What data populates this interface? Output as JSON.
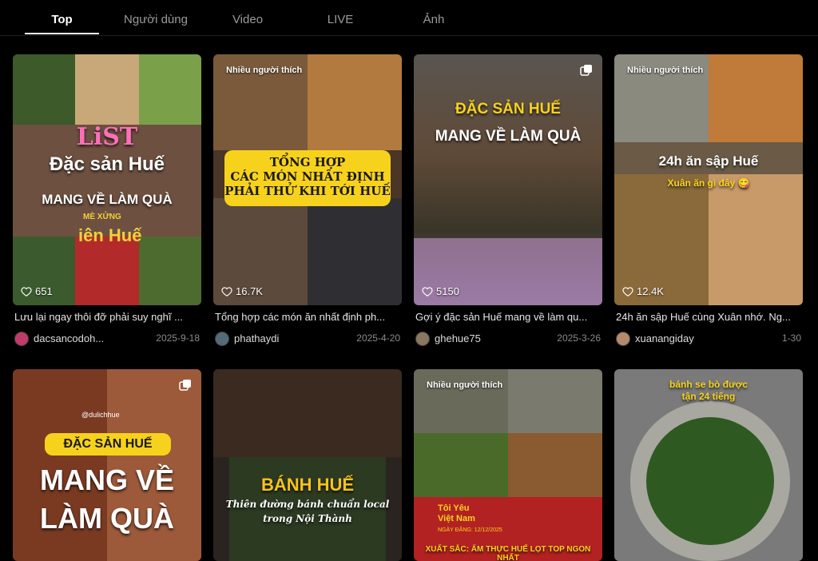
{
  "tabs": [
    {
      "label": "Top",
      "active": true
    },
    {
      "label": "Người dùng",
      "active": false
    },
    {
      "label": "Video",
      "active": false
    },
    {
      "label": "LIVE",
      "active": false
    },
    {
      "label": "Ảnh",
      "active": false
    }
  ],
  "cards": [
    {
      "overlay": {
        "line1": "LiST",
        "line2": "Đặc sản Huế",
        "line3": "MANG VỀ LÀM QUÀ",
        "small": "MÈ XỬNG",
        "small2": "iên Huế"
      },
      "likes": "651",
      "caption": "Lưu lại ngay thôi đỡ phải suy nghĩ ...",
      "user": "dacsancodoh...",
      "date": "2025-9-18"
    },
    {
      "badge": "Nhiều người thích",
      "overlay": {
        "line1": "TỔNG HỢP",
        "line2": "CÁC MÓN NHẤT ĐỊNH",
        "line3": "PHẢI THỬ KHI TỚI HUẾ"
      },
      "likes": "16.7K",
      "caption": "Tổng hợp các món ăn nhất định ph...",
      "user": "phathaydi",
      "date": "2025-4-20"
    },
    {
      "overlay": {
        "line1": "ĐẶC SẢN HUẾ",
        "line2": "MANG VỀ LÀM QUÀ"
      },
      "likes": "5150",
      "caption": "Gợi ý đặc sản Huế mang về làm qu...",
      "user": "ghehue75",
      "date": "2025-3-26"
    },
    {
      "badge": "Nhiều người thích",
      "overlay": {
        "line1": "24h ăn sập Huế",
        "line2": "Xuân ăn gì đây 😋"
      },
      "likes": "12.4K",
      "caption": "24h ăn sập Huế cùng Xuân nhớ. Ng...",
      "user": "xuanangiday",
      "date": "1-30"
    },
    {
      "overlay": {
        "small": "@dulichhue",
        "line1": "ĐẶC SẢN HUẾ",
        "line2": "MANG VỀ",
        "line3": "LÀM QUÀ"
      }
    },
    {
      "overlay": {
        "line1": "BÁNH HUẾ",
        "line2": "Thiên đường bánh chuẩn local",
        "line3": "trong Nội Thành"
      }
    },
    {
      "badge": "Nhiều người thích",
      "overlay": {
        "line1": "Tôi Yêu",
        "line2": "Việt Nam",
        "line3": "NGÀY ĐĂNG: 12/12/2025",
        "bottom": "XUẤT SẮC: ẨM THỰC HUẾ LỌT TOP NGON NHẤT"
      }
    },
    {
      "overlay": {
        "line1": "bánh se bò được",
        "line2": "tận 24 tiếng"
      }
    }
  ],
  "icons": {
    "heart": "heart-outline-icon",
    "multi": "multiple-images-icon"
  }
}
